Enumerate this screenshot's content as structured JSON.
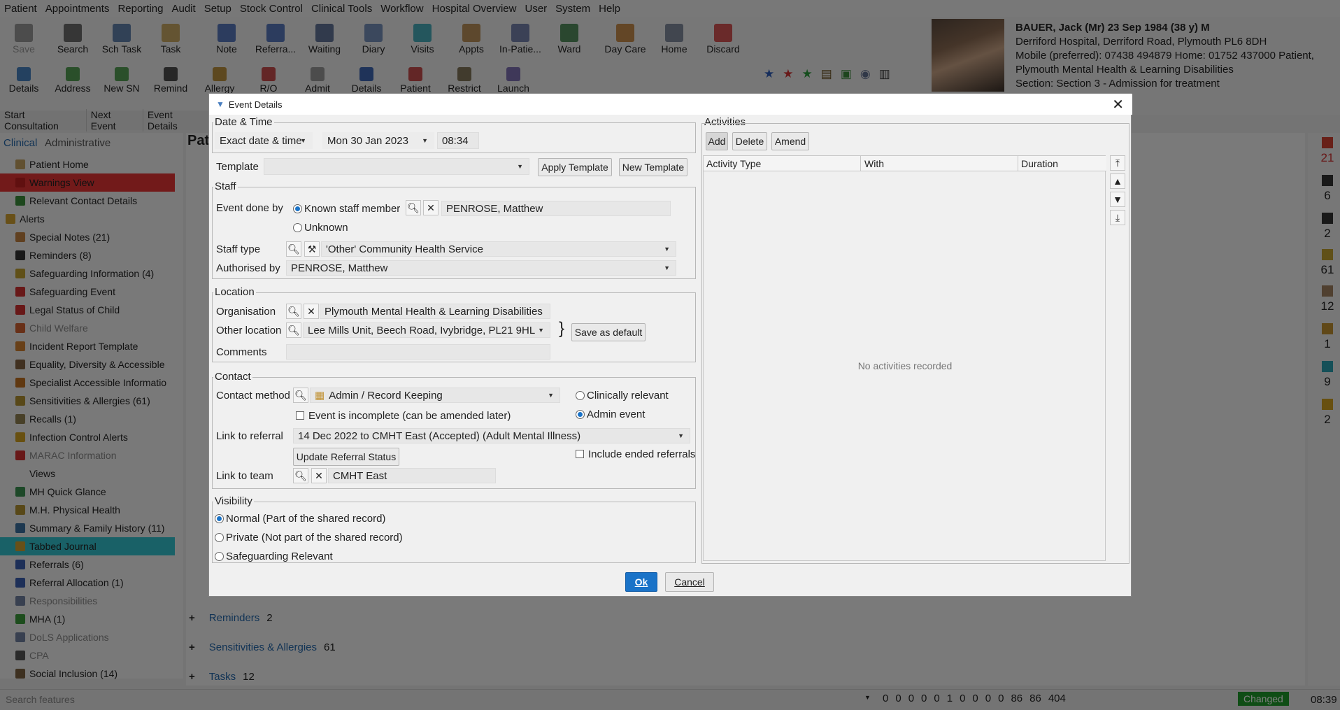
{
  "menu": [
    "Patient",
    "Appointments",
    "Reporting",
    "Audit",
    "Setup",
    "Stock Control",
    "Clinical Tools",
    "Workflow",
    "Hospital Overview",
    "User",
    "System",
    "Help"
  ],
  "toolbar_row1": [
    {
      "label": "Save",
      "disabled": true,
      "color": "#8a8a8a"
    },
    {
      "label": "Search",
      "color": "#555555"
    },
    {
      "label": "Sch Task",
      "color": "#4a6fa0"
    },
    {
      "label": "Task",
      "color": "#c29b4b"
    },
    {
      "label": "Note",
      "color": "#3d63b3"
    },
    {
      "label": "Referra...",
      "color": "#3d63b3"
    },
    {
      "label": "Waiting",
      "color": "#4a5f8a"
    },
    {
      "label": "Diary",
      "color": "#6080b0"
    },
    {
      "label": "Visits",
      "color": "#2aa0b0"
    },
    {
      "label": "Appts",
      "color": "#b08040"
    },
    {
      "label": "In-Patie...",
      "color": "#6070a0"
    },
    {
      "label": "Ward",
      "color": "#3a7d44"
    },
    {
      "label": "Day Care",
      "color": "#c07a30"
    },
    {
      "label": "Home",
      "color": "#707a90"
    },
    {
      "label": "Discard",
      "color": "#d03a3a"
    }
  ],
  "toolbar_row2": [
    {
      "label": "Details",
      "color": "#2a70b8"
    },
    {
      "label": "Address",
      "color": "#3a8f3a"
    },
    {
      "label": "New SN",
      "color": "#3a8f3a"
    },
    {
      "label": "Remind",
      "color": "#333333"
    },
    {
      "label": "Allergy",
      "color": "#b08020"
    },
    {
      "label": "R/O",
      "color": "#c03030"
    },
    {
      "label": "Admit",
      "color": "#8a8a8a"
    },
    {
      "label": "Details",
      "color": "#1f4fa8"
    },
    {
      "label": "Patient",
      "color": "#c03030"
    },
    {
      "label": "Restrict",
      "color": "#706040"
    },
    {
      "label": "Launch",
      "color": "#6a5aa8"
    }
  ],
  "patient": {
    "name_line": "BAUER, Jack (Mr) 23 Sep 1984 (38 y) M",
    "address": "Derriford Hospital, Derriford Road, Plymouth PL6 8DH",
    "phones": "Mobile (preferred): 07438 494879 Home: 01752 437000   Patient,",
    "org": "Plymouth Mental Health & Learning Disabilities",
    "section": "Section: Section 3 - Admission for treatment"
  },
  "bar2": [
    "Start Consultation",
    "Next Event",
    "Event Details"
  ],
  "left_tabs": {
    "clinical": "Clinical",
    "administrative": "Administrative"
  },
  "nav": [
    {
      "label": "Patient Home",
      "color": "#c2a060"
    },
    {
      "label": "Warnings View",
      "color": "#c02020",
      "state": "warn"
    },
    {
      "label": "Relevant Contact Details",
      "color": "#3a8f3a"
    },
    {
      "label": "Alerts",
      "color": "#d0a030",
      "indent": 0
    },
    {
      "label": "Special Notes (21)",
      "color": "#c08040"
    },
    {
      "label": "Reminders (8)",
      "color": "#333333"
    },
    {
      "label": "Safeguarding Information (4)",
      "color": "#c0a030"
    },
    {
      "label": "Safeguarding Event",
      "color": "#d03030"
    },
    {
      "label": "Legal Status of Child",
      "color": "#d03030"
    },
    {
      "label": "Child Welfare",
      "color": "#d06030",
      "state": "dim"
    },
    {
      "label": "Incident Report Template",
      "color": "#d08030"
    },
    {
      "label": "Equality, Diversity & Accessible",
      "color": "#806040"
    },
    {
      "label": "Specialist Accessible Informatio",
      "color": "#c07020"
    },
    {
      "label": "Sensitivities & Allergies (61)",
      "color": "#b09030"
    },
    {
      "label": "Recalls (1)",
      "color": "#908050"
    },
    {
      "label": "Infection Control Alerts",
      "color": "#d0a020"
    },
    {
      "label": "MARAC Information",
      "color": "#d03030",
      "state": "dim"
    },
    {
      "label": "Views",
      "color": "#f3f3f3"
    },
    {
      "label": "MH Quick Glance",
      "color": "#3a9050"
    },
    {
      "label": "M.H. Physical Health",
      "color": "#b09030"
    },
    {
      "label": "Summary & Family History (11)",
      "color": "#3a70a0"
    },
    {
      "label": "Tabbed Journal",
      "color": "#d0a030",
      "state": "sel"
    },
    {
      "label": "Referrals (6)",
      "color": "#3a5fb0"
    },
    {
      "label": "Referral Allocation (1)",
      "color": "#3a5fb0"
    },
    {
      "label": "Responsibilities",
      "color": "#7080a0",
      "state": "dim"
    },
    {
      "label": "MHA (1)",
      "color": "#3a9a3a"
    },
    {
      "label": "DoLS Applications",
      "color": "#7080a0",
      "state": "dim"
    },
    {
      "label": "CPA",
      "color": "#555555",
      "state": "dim"
    },
    {
      "label": "Social Inclusion (14)",
      "color": "#7a6040"
    }
  ],
  "main_rows": [
    {
      "label": "Reminders",
      "count": "2"
    },
    {
      "label": "Sensitivities & Allergies",
      "count": "61"
    },
    {
      "label": "Tasks",
      "count": "12"
    }
  ],
  "right_strip": [
    "21",
    "6",
    "2",
    "61",
    "12",
    "1",
    "9",
    "2"
  ],
  "status": {
    "search_placeholder": "Search features",
    "counts": [
      "0",
      "0",
      "0",
      "0",
      "0",
      "1",
      "0",
      "0",
      "0",
      "0",
      "86",
      "86",
      "404"
    ],
    "changed": "Changed",
    "time": "08:39"
  },
  "dialog": {
    "title": "Event Details",
    "date_time": {
      "legend": "Date & Time",
      "mode": "Exact date & time",
      "date": "Mon 30 Jan 2023",
      "time": "08:34"
    },
    "template": {
      "label": "Template",
      "value": "",
      "apply": "Apply Template",
      "new": "New Template"
    },
    "staff": {
      "legend": "Staff",
      "done_by_label": "Event done by",
      "known": "Known staff member",
      "unknown": "Unknown",
      "staff_name": "PENROSE, Matthew",
      "staff_type_label": "Staff type",
      "staff_type": "'Other' Community Health Service",
      "authorised_label": "Authorised by",
      "authorised": "PENROSE, Matthew"
    },
    "location": {
      "legend": "Location",
      "org_label": "Organisation",
      "org": "Plymouth Mental Health & Learning Disabilities",
      "other_label": "Other location",
      "other": "Lee Mills Unit, Beech Road, Ivybridge, PL21 9HL",
      "save_default": "Save as default",
      "comments_label": "Comments",
      "comments": ""
    },
    "contact": {
      "legend": "Contact",
      "method_label": "Contact method",
      "method": "Admin / Record Keeping",
      "clinically": "Clinically relevant",
      "admin": "Admin event",
      "incomplete": "Event is incomplete (can be amended later)",
      "referral_label": "Link to referral",
      "referral": "14 Dec 2022 to CMHT East (Accepted)  (Adult Mental Illness)",
      "update_status": "Update Referral Status",
      "include_ended": "Include ended referrals",
      "team_label": "Link to team",
      "team": "CMHT East"
    },
    "visibility": {
      "legend": "Visibility",
      "normal": "Normal (Part of the shared record)",
      "private": "Private (Not part of the shared record)",
      "safeguarding": "Safeguarding Relevant"
    },
    "activities": {
      "legend": "Activities",
      "add": "Add",
      "delete": "Delete",
      "amend": "Amend",
      "cols": [
        "Activity Type",
        "With",
        "Duration"
      ],
      "empty": "No activities recorded"
    },
    "ok": "Ok",
    "cancel": "Cancel"
  }
}
